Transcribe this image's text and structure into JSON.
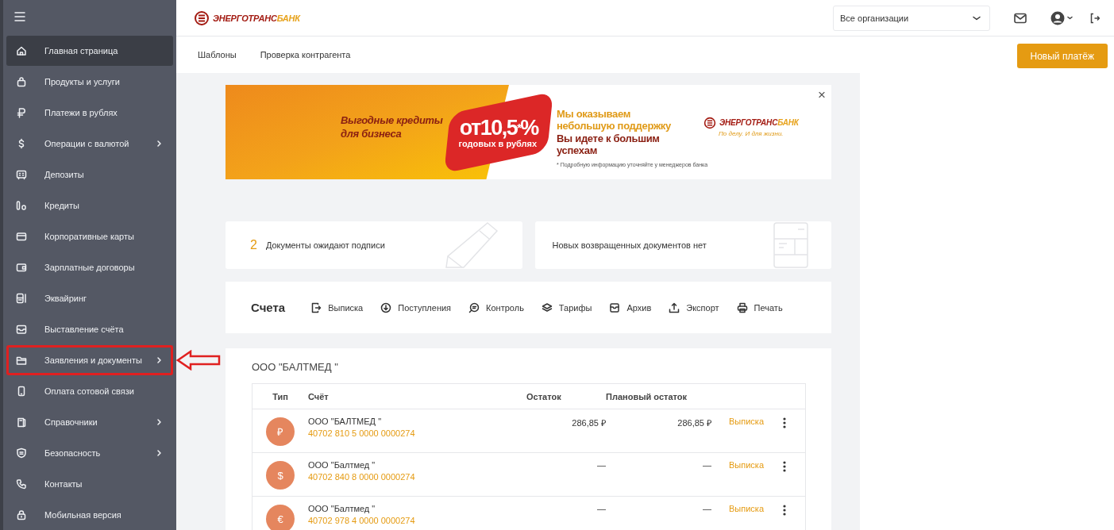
{
  "sidebar": {
    "items": [
      {
        "label": "Главная страница",
        "selected": true,
        "highlighted": false,
        "expandable": false
      },
      {
        "label": "Продукты и услуги",
        "selected": false,
        "highlighted": false,
        "expandable": false
      },
      {
        "label": "Платежи в рублях",
        "selected": false,
        "highlighted": false,
        "expandable": false
      },
      {
        "label": "Операции с валютой",
        "selected": false,
        "highlighted": false,
        "expandable": true
      },
      {
        "label": "Депозиты",
        "selected": false,
        "highlighted": false,
        "expandable": false
      },
      {
        "label": "Кредиты",
        "selected": false,
        "highlighted": false,
        "expandable": false
      },
      {
        "label": "Корпоративные карты",
        "selected": false,
        "highlighted": false,
        "expandable": false
      },
      {
        "label": "Зарплатные договоры",
        "selected": false,
        "highlighted": false,
        "expandable": false
      },
      {
        "label": "Эквайринг",
        "selected": false,
        "highlighted": false,
        "expandable": false
      },
      {
        "label": "Выставление счёта",
        "selected": false,
        "highlighted": false,
        "expandable": false
      },
      {
        "label": "Заявления и документы",
        "selected": false,
        "highlighted": true,
        "expandable": true
      },
      {
        "label": "Оплата сотовой связи",
        "selected": false,
        "highlighted": false,
        "expandable": false
      },
      {
        "label": "Справочники",
        "selected": false,
        "highlighted": false,
        "expandable": true
      },
      {
        "label": "Безопасность",
        "selected": false,
        "highlighted": false,
        "expandable": true
      },
      {
        "label": "Контакты",
        "selected": false,
        "highlighted": false,
        "expandable": false
      },
      {
        "label": "Мобильная версия",
        "selected": false,
        "highlighted": false,
        "expandable": false
      }
    ]
  },
  "header": {
    "logo": {
      "part_1": "ЭНЕРГОТРАНС",
      "part_2": "БАНК"
    },
    "organization_select": {
      "value": "Все организации"
    }
  },
  "subnav": {
    "links": [
      "Шаблоны",
      "Проверка контрагента"
    ],
    "new_payment_button": "Новый платёж"
  },
  "banner": {
    "headline": "Выгодные кредиты для бизнеса",
    "rate": "от10,5",
    "rate_mark": "*",
    "rate_percent": "%",
    "rate_note": "годовых в рублях",
    "slogan_1": "Мы оказываем небольшую поддержку",
    "slogan_2": "Вы идете к большим успехам",
    "footnote": "* Подробную информацию уточняйте у менеджеров банка",
    "logo_part_1": "ЭНЕРГОТРАНС",
    "logo_part_2": "БАНК",
    "logo_tagline": "По делу. И для жизни.",
    "close": "×"
  },
  "info_cards": [
    {
      "count": "2",
      "text": "Документы ожидают подписи"
    },
    {
      "text": "Новых возвращенных документов нет"
    }
  ],
  "accounts_toolbar": {
    "title": "Счета",
    "actions": [
      "Выписка",
      "Поступления",
      "Контроль",
      "Тарифы",
      "Архив",
      "Экспорт",
      "Печать"
    ]
  },
  "accounts": {
    "company": "ООО \"БАЛТМЕД \"",
    "columns": [
      "Тип",
      "Счёт",
      "Остаток",
      "Плановый остаток"
    ],
    "rows": [
      {
        "currency": "₽",
        "name": "ООО \"БАЛТМЕД \"",
        "number": "40702 810 5 0000 0000274",
        "balance": "286,85 ₽",
        "planned_balance": "286,85 ₽",
        "action": "Выписка"
      },
      {
        "currency": "$",
        "name": "ООО \"Балтмед \"",
        "number": "40702 840 8 0000 0000274",
        "balance": "—",
        "planned_balance": "—",
        "action": "Выписка"
      },
      {
        "currency": "€",
        "name": "ООО \"Балтмед \"",
        "number": "40702 978 4 0000 0000274",
        "balance": "—",
        "planned_balance": "—",
        "action": "Выписка"
      }
    ]
  }
}
